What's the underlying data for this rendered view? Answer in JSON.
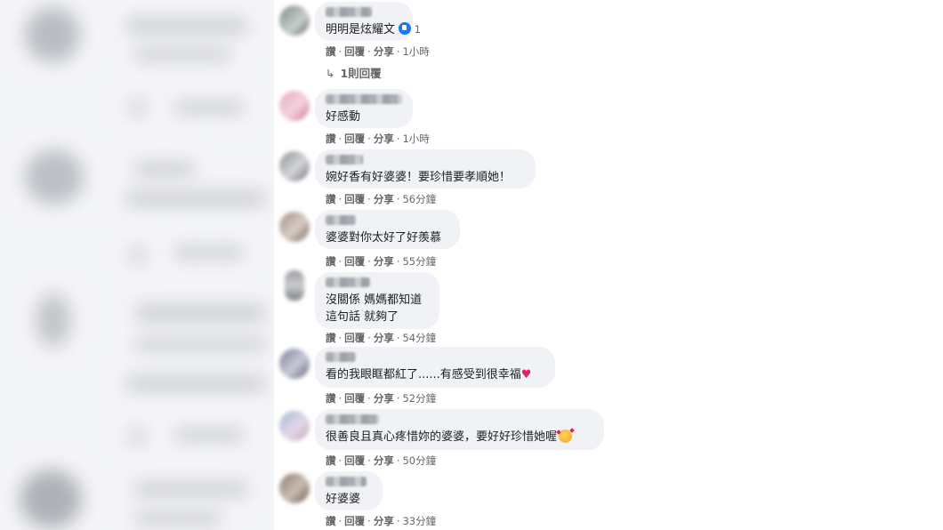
{
  "actions": {
    "like": "讚",
    "reply": "回覆",
    "share": "分享",
    "sep": "·"
  },
  "comments": [
    {
      "text": "明明是炫耀文",
      "reaction_count": "1",
      "time": "1小時",
      "replies_link": "1則回覆"
    },
    {
      "text": "好感動",
      "time": "1小時"
    },
    {
      "text": "婉好香有好婆婆！要珍惜要孝順她！",
      "time": "56分鐘"
    },
    {
      "text": "婆婆對你太好了好羨慕",
      "time": "55分鐘"
    },
    {
      "text_lines": [
        "沒關係 媽媽都知道",
        "這句話 就夠了"
      ],
      "time": "54分鐘"
    },
    {
      "text": "看的我眼眶都紅了......有感受到很幸福",
      "time": "52分鐘",
      "emoji": "heart-icon"
    },
    {
      "text": "很善良且真心疼惜妳的婆婆，要好好珍惜她喔",
      "time": "50分鐘",
      "emoji": "smiling-face-with-hearts-icon"
    },
    {
      "text": "好婆婆",
      "time": "33分鐘"
    }
  ],
  "colors": {
    "bubble": "#f0f2f5",
    "text": "#1c1e21",
    "meta": "#65676b",
    "like_blue": "#1877f2",
    "heart": "#e0245e"
  }
}
